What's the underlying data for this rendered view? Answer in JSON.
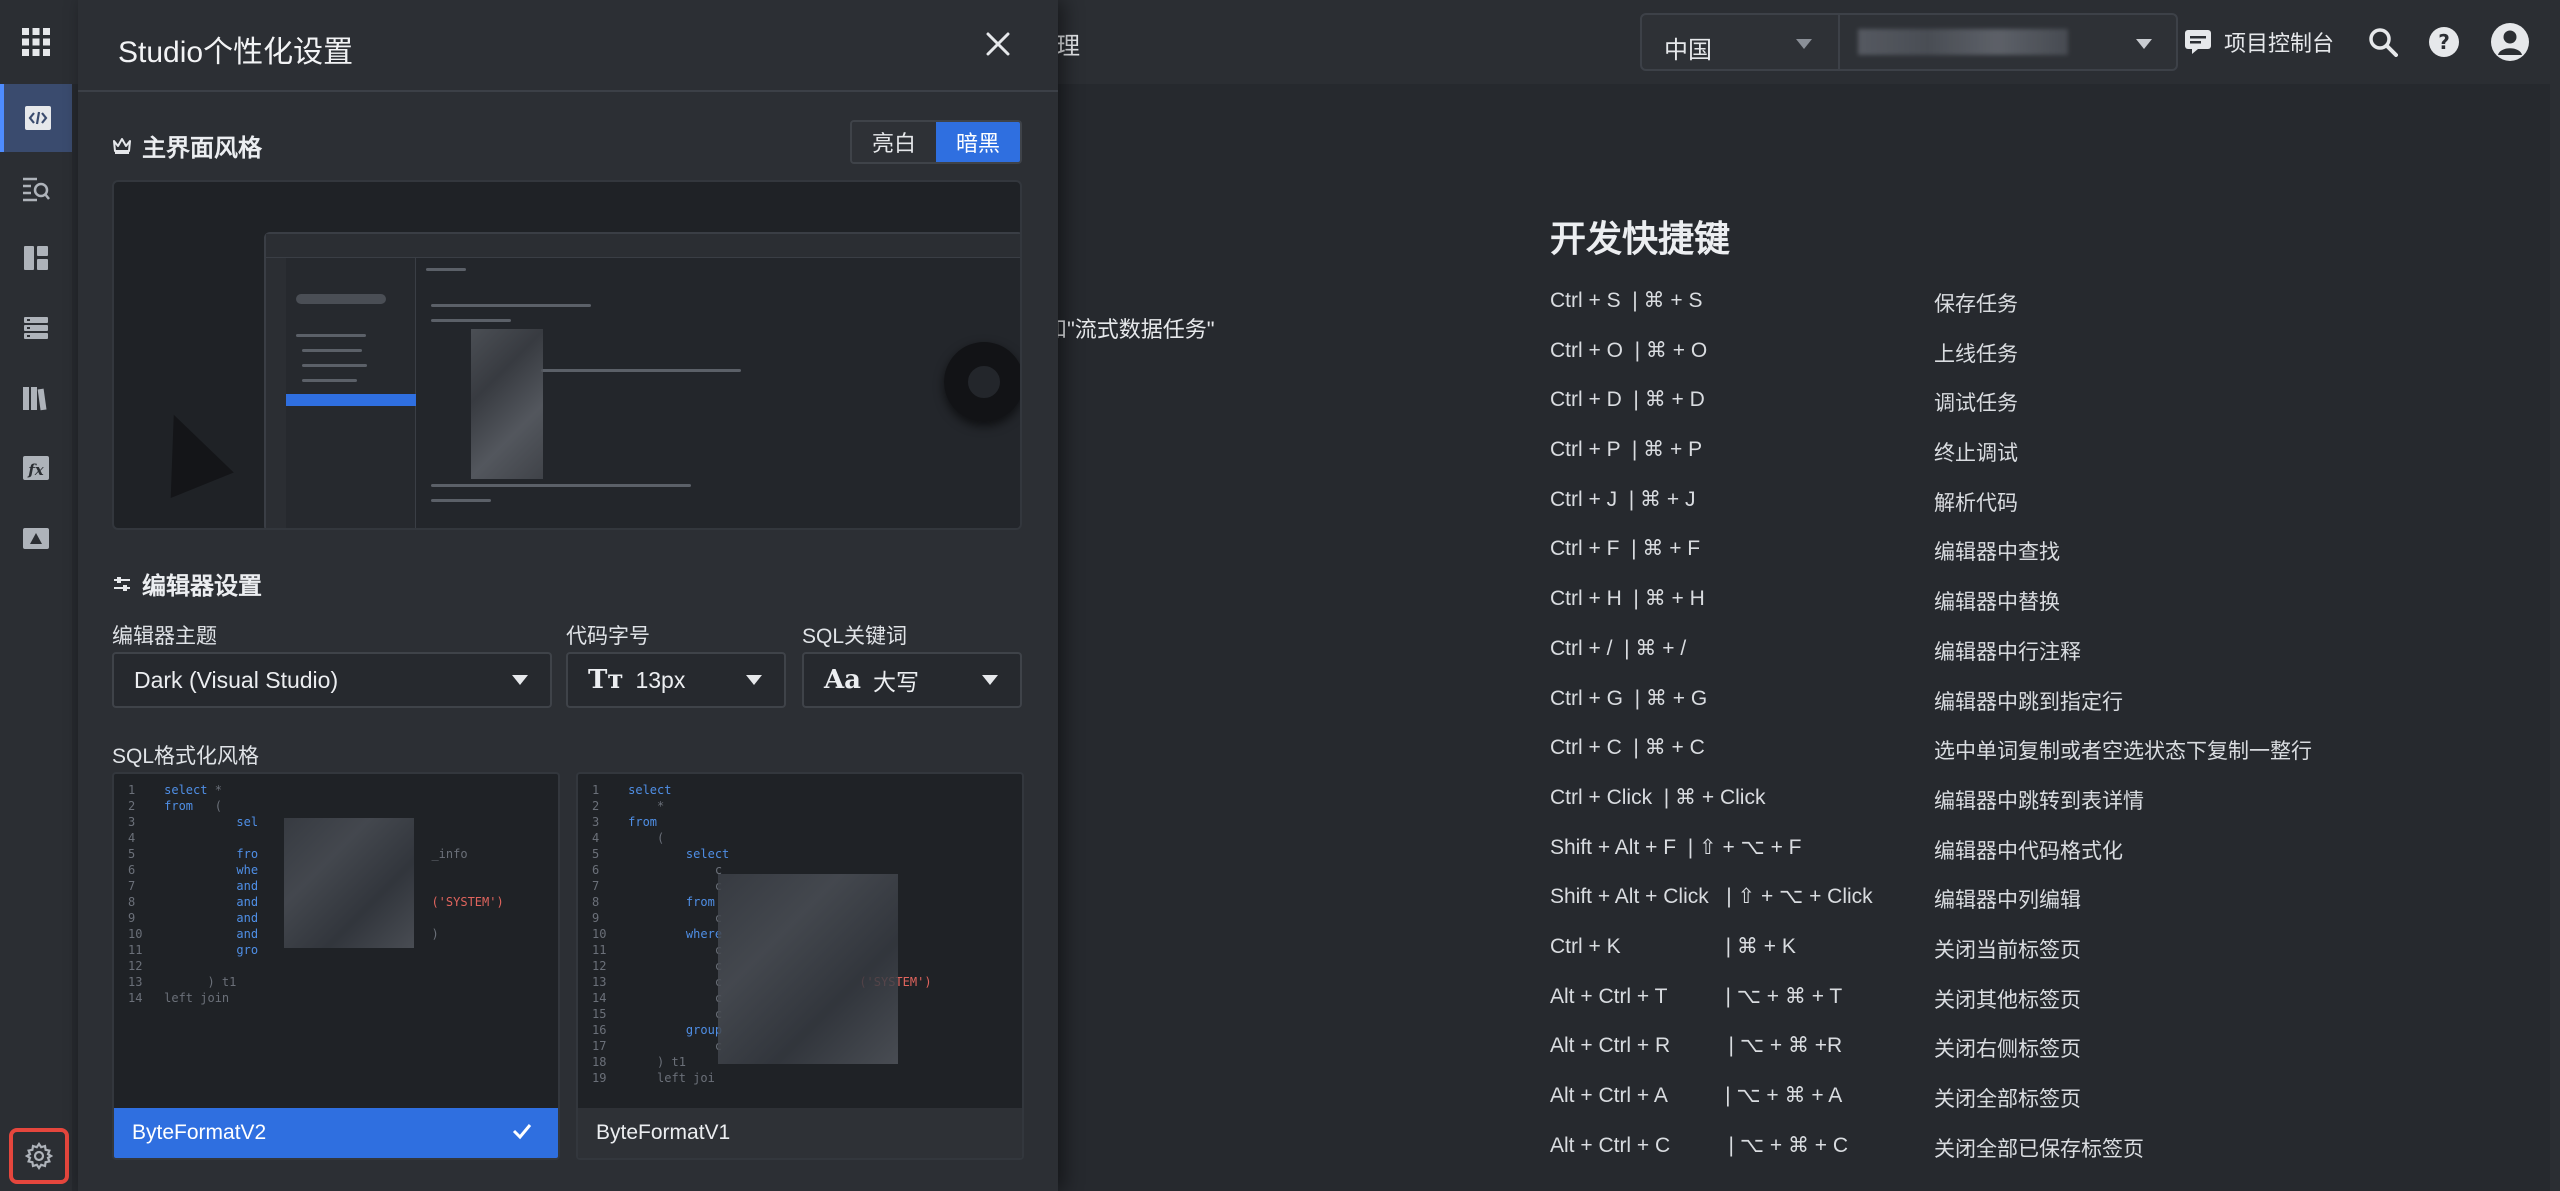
{
  "topbar": {
    "crumb_fragment": "理",
    "region_label": "中国",
    "console_label": "项目控制台"
  },
  "background": {
    "fragment_text": "和\"流式数据任务\""
  },
  "shortcuts": {
    "title": "开发快捷键",
    "rows": [
      {
        "keys": "Ctrl + S  | ⌘ + S",
        "desc": "保存任务"
      },
      {
        "keys": "Ctrl + O  | ⌘ + O",
        "desc": "上线任务"
      },
      {
        "keys": "Ctrl + D  | ⌘ + D",
        "desc": "调试任务"
      },
      {
        "keys": "Ctrl + P  | ⌘ + P",
        "desc": "终止调试"
      },
      {
        "keys": "Ctrl + J  | ⌘ + J",
        "desc": "解析代码"
      },
      {
        "keys": "Ctrl + F  | ⌘ + F",
        "desc": "编辑器中查找"
      },
      {
        "keys": "Ctrl + H  | ⌘ + H",
        "desc": "编辑器中替换"
      },
      {
        "keys": "Ctrl + /  | ⌘ + /",
        "desc": "编辑器中行注释"
      },
      {
        "keys": "Ctrl + G  | ⌘ + G",
        "desc": "编辑器中跳到指定行"
      },
      {
        "keys": "Ctrl + C  | ⌘ + C",
        "desc": "选中单词复制或者空选状态下复制一整行"
      },
      {
        "keys": "Ctrl + Click  | ⌘ + Click",
        "desc": "编辑器中跳转到表详情"
      },
      {
        "keys": "Shift + Alt + F  | ⇧ + ⌥ + F",
        "desc": "编辑器中代码格式化"
      },
      {
        "keys": "Shift + Alt + Click   | ⇧ + ⌥ + Click",
        "desc": "编辑器中列编辑"
      },
      {
        "keys": "Ctrl + K                  | ⌘ + K",
        "desc": "关闭当前标签页"
      },
      {
        "keys": "Alt + Ctrl + T          | ⌥ + ⌘ + T",
        "desc": "关闭其他标签页"
      },
      {
        "keys": "Alt + Ctrl + R          | ⌥ + ⌘ +R",
        "desc": "关闭右侧标签页"
      },
      {
        "keys": "Alt + Ctrl + A          | ⌥ + ⌘ + A",
        "desc": "关闭全部标签页"
      },
      {
        "keys": "Alt + Ctrl + C          | ⌥ + ⌘ + C",
        "desc": "关闭全部已保存标签页"
      }
    ]
  },
  "panel": {
    "title": "Studio个性化设置",
    "ui_style": {
      "title": "主界面风格",
      "options": [
        "亮白",
        "暗黑"
      ],
      "selected": "暗黑"
    },
    "editor": {
      "title": "编辑器设置",
      "theme_label": "编辑器主题",
      "theme_value": "Dark (Visual Studio)",
      "font_label": "代码字号",
      "font_value": "13px",
      "keyword_label": "SQL关键词",
      "keyword_value": "大写"
    },
    "sql_format": {
      "title": "SQL格式化风格",
      "options": [
        {
          "name": "ByteFormatV2",
          "selected": true
        },
        {
          "name": "ByteFormatV1",
          "selected": false
        }
      ]
    }
  },
  "colors": {
    "accent": "#2f6fe0",
    "highlight_box": "#e5463d",
    "panel_bg": "#2c2f34",
    "page_bg": "#26292e"
  }
}
